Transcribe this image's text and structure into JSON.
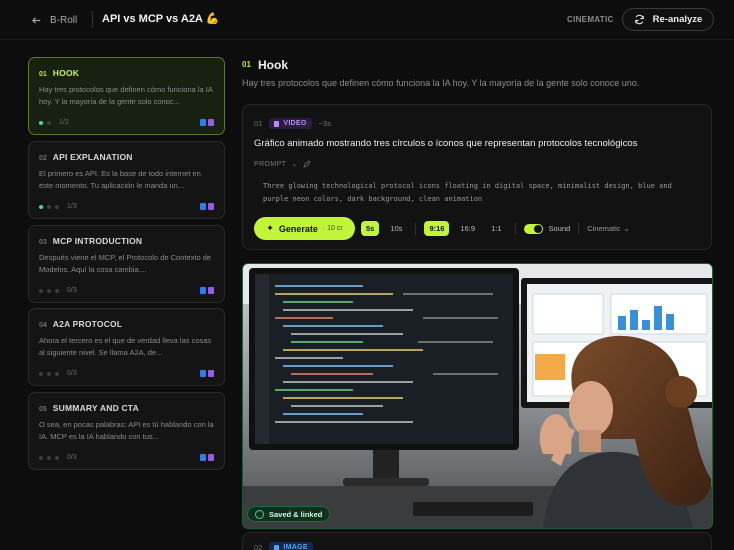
{
  "header": {
    "back_label": "B-Roll",
    "project_title": "API vs MCP vs A2A 💪",
    "style_label": "CINEMATIC",
    "reanalyze_label": "Re-analyze"
  },
  "sidebar": {
    "cards": [
      {
        "num": "01",
        "title": "HOOK",
        "desc": "Hay tres protocolos que definen cómo funciona la IA hoy. Y la mayoría de la gente solo conoc...",
        "progress": "1/2",
        "done": 1,
        "total": 2
      },
      {
        "num": "02",
        "title": "API EXPLANATION",
        "desc": "El primero es API. Es la base de todo internet en este momento. Tu aplicación le manda un...",
        "progress": "1/3",
        "done": 1,
        "total": 3
      },
      {
        "num": "03",
        "title": "MCP INTRODUCTION",
        "desc": "Después viene el MCP, el Protocolo de Contexto de Modelos. Aquí la cosa cambia....",
        "progress": "0/3",
        "done": 0,
        "total": 3
      },
      {
        "num": "04",
        "title": "A2A PROTOCOL",
        "desc": "Ahora el tercero es el que de verdad lleva las cosas al siguiente nivel. Se llama A2A, de...",
        "progress": "0/3",
        "done": 0,
        "total": 3
      },
      {
        "num": "05",
        "title": "SUMMARY AND CTA",
        "desc": "O sea, en pocas palabras: API es tú hablando con la IA. MCP es la IA hablando con tus...",
        "progress": "0/3",
        "done": 0,
        "total": 3
      }
    ]
  },
  "main": {
    "section_num": "01",
    "section_title": "Hook",
    "section_text": "Hay tres protocolos que definen cómo funciona la IA hoy. Y la mayoría de la gente solo conoce uno.",
    "shot1": {
      "num": "01",
      "type": "VIDEO",
      "duration": "~3s",
      "description": "Gráfico animado mostrando tres círculos o íconos que representan protocolos tecnológicos",
      "prompt_label": "PROMPT",
      "prompt_text": "Three glowing technological protocol icons floating in digital space, minimalist design, blue and purple neon colors, dark background, clean animation",
      "generate_label": "Generate",
      "generate_cost": "· 10 cr",
      "durations": [
        "5s",
        "10s"
      ],
      "selected_duration": "5s",
      "ratios": [
        "9:16",
        "16:9",
        "1:1"
      ],
      "selected_ratio": "9:16",
      "sound_label": "Sound",
      "sound_on": true,
      "style_select": "Cinematic"
    },
    "saved_label": "Saved & linked",
    "shot2": {
      "num": "02",
      "type": "IMAGE"
    }
  },
  "colors": {
    "accent": "#c2f53a",
    "video": "#b98cf2",
    "image": "#5ca0f5",
    "saved": "#3bd98a"
  }
}
